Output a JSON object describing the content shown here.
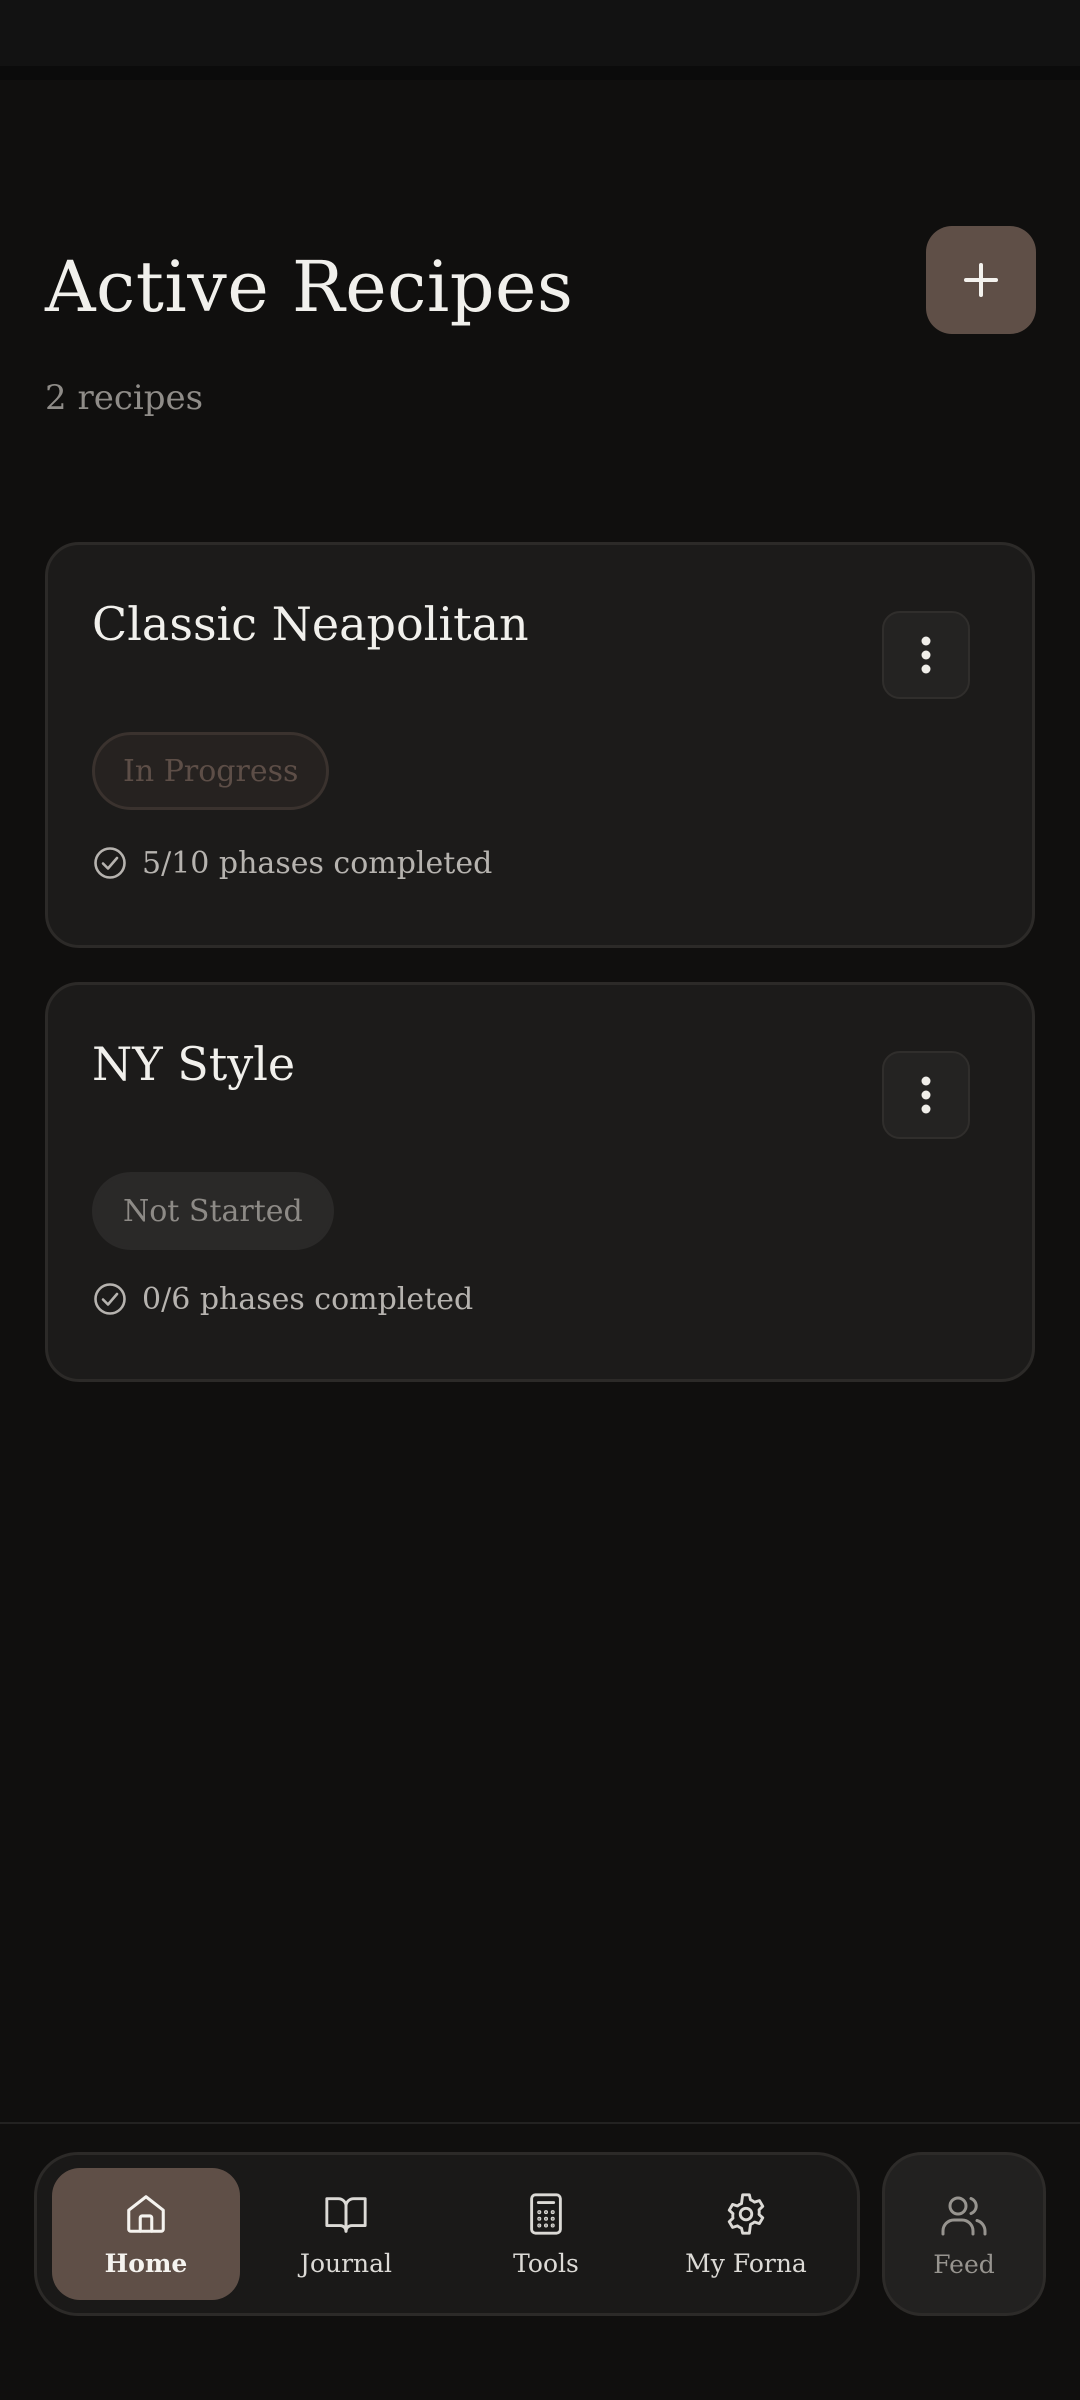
{
  "header": {
    "title": "Active Recipes",
    "count": "2 recipes",
    "add_icon": "plus-icon"
  },
  "recipes": [
    {
      "name": "Classic Neapolitan",
      "status": "In Progress",
      "phases": "5/10 phases completed",
      "menu_icon": "more-vertical-icon"
    },
    {
      "name": "NY Style",
      "status": "Not Started",
      "phases": "0/6 phases completed",
      "menu_icon": "more-vertical-icon"
    }
  ],
  "nav": {
    "items": [
      {
        "label": "Home",
        "icon": "home-icon",
        "active": true
      },
      {
        "label": "Journal",
        "icon": "book-open-icon",
        "active": false
      },
      {
        "label": "Tools",
        "icon": "calculator-icon",
        "active": false
      },
      {
        "label": "My Forna",
        "icon": "gear-icon",
        "active": false
      }
    ],
    "feed": {
      "label": "Feed",
      "icon": "users-icon"
    }
  },
  "colors": {
    "background": "#100f0e",
    "accent": "#5f4f47",
    "card": "#1c1b1a",
    "text": "#f1f0ec",
    "muted": "#8f8c88"
  }
}
